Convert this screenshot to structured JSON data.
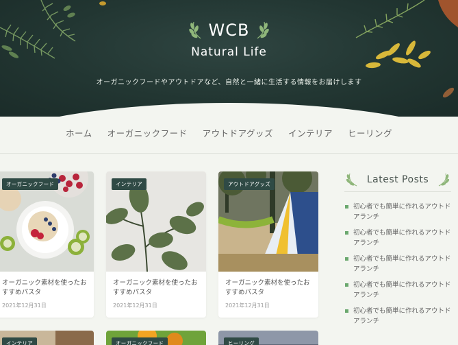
{
  "site": {
    "logo_title": "WCB",
    "logo_subtitle": "Natural Life",
    "tagline": "オーガニックフードやアウトドアなど、自然と一緒に生活する情報をお届けします"
  },
  "nav": {
    "items": [
      "ホーム",
      "オーガニックフード",
      "アウトドアグッズ",
      "インテリア",
      "ヒーリング"
    ]
  },
  "posts": [
    {
      "category": "オーガニックフード",
      "title": "オーガニック素材を使ったおすすめパスタ",
      "date": "2021年12月31日"
    },
    {
      "category": "インテリア",
      "title": "オーガニック素材を使ったおすすめパスタ",
      "date": "2021年12月31日"
    },
    {
      "category": "アウトドアグッズ",
      "title": "オーガニック素材を使ったおすすめパスタ",
      "date": "2021年12月31日"
    }
  ],
  "posts_next_row": [
    {
      "category": "インテリア"
    },
    {
      "category": "オーガニックフード"
    },
    {
      "category": "ヒーリング"
    }
  ],
  "sidebar": {
    "title": "Latest Posts",
    "items": [
      "初心者でも簡単に作れるアウトドアランチ",
      "初心者でも簡単に作れるアウトドアランチ",
      "初心者でも簡単に作れるアウトドアランチ",
      "初心者でも簡単に作れるアウトドアランチ",
      "初心者でも簡単に作れるアウトドアランチ"
    ]
  },
  "colors": {
    "hero_bg": "#223632",
    "badge_bg": "#2f4a45",
    "accent_green": "#6aa86e",
    "page_bg": "#f3f5f0"
  }
}
